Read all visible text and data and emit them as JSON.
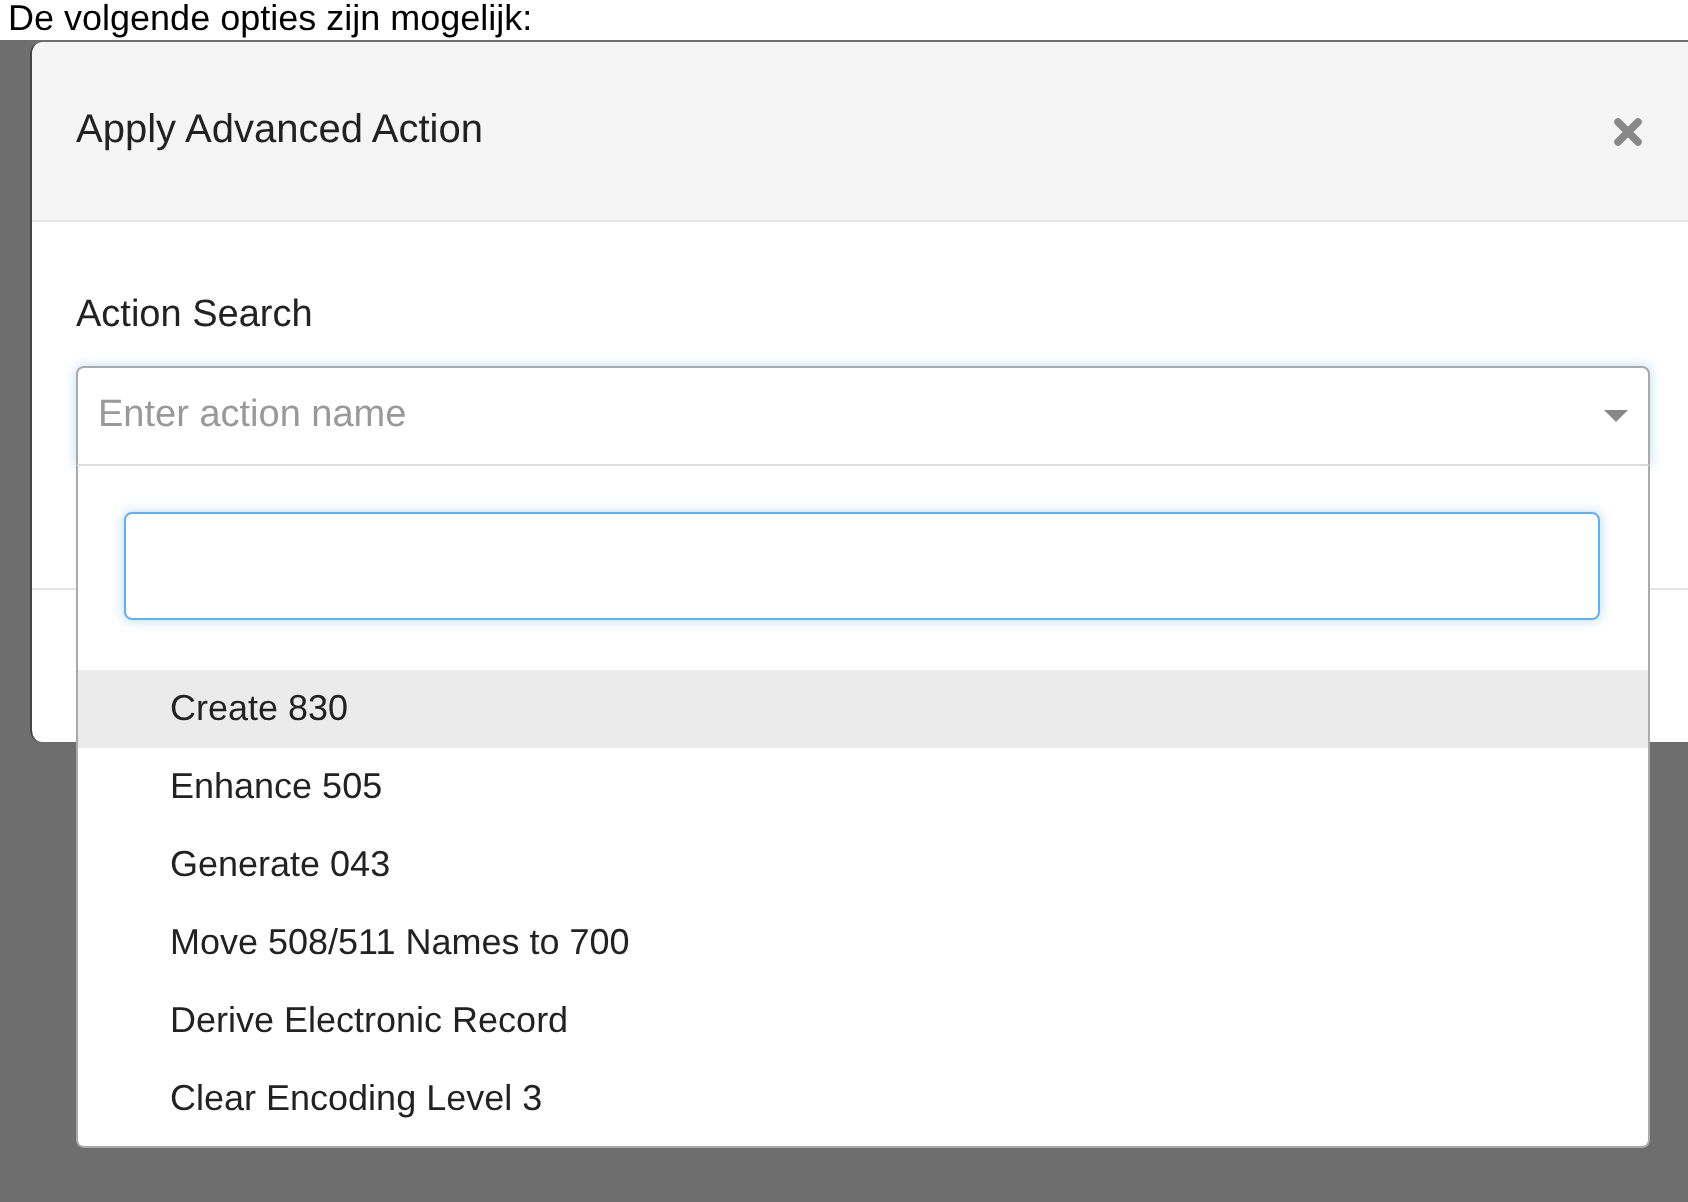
{
  "page_text": "De volgende opties zijn mogelijk:",
  "modal": {
    "title": "Apply Advanced Action",
    "field_label": "Action Search",
    "select": {
      "placeholder": "Enter action name",
      "expanded": true
    },
    "dropdown": {
      "options": [
        {
          "label": "Create 830",
          "selected": true
        },
        {
          "label": "Enhance 505",
          "selected": false
        },
        {
          "label": "Generate 043",
          "selected": false
        },
        {
          "label": "Move 508/511 Names to 700",
          "selected": false
        },
        {
          "label": "Derive Electronic Record",
          "selected": false
        },
        {
          "label": "Clear Encoding Level 3",
          "selected": false
        }
      ]
    }
  }
}
